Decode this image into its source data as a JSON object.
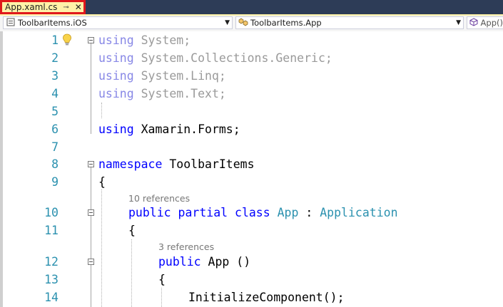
{
  "tab": {
    "title": "App.xaml.cs",
    "pin_icon": "pin-icon",
    "close_icon": "close-icon"
  },
  "navbar": {
    "project": "ToolbarItems.iOS",
    "type": "ToolbarItems.App",
    "member": "App()"
  },
  "colors": {
    "keyword": "#0000ff",
    "type": "#2b91af",
    "tab_highlight": "#e0181c",
    "line_number": "#2b91af"
  },
  "lines": [
    {
      "n": "1",
      "a": "using",
      "b": " System;"
    },
    {
      "n": "2",
      "a": "using",
      "b": " System.Collections.Generic;"
    },
    {
      "n": "3",
      "a": "using",
      "b": " System.Linq;"
    },
    {
      "n": "4",
      "a": "using",
      "b": " System.Text;"
    },
    {
      "n": "5"
    },
    {
      "n": "6",
      "a": "using",
      "b": " Xamarin.Forms;"
    },
    {
      "n": "7"
    },
    {
      "n": "8",
      "a": "namespace",
      "b": " ToolbarItems"
    },
    {
      "n": "9",
      "a": "{"
    },
    {
      "n": "10",
      "a": "public partial class",
      "b": " App",
      "c": " : ",
      "d": "Application"
    },
    {
      "n": "11",
      "a": "{"
    },
    {
      "n": "12",
      "a": "public",
      "b": " App ()"
    },
    {
      "n": "13",
      "a": "{"
    },
    {
      "n": "14",
      "a": "InitializeComponent();"
    }
  ],
  "references": {
    "class_refs": "10 references",
    "ctor_refs": "3 references"
  }
}
